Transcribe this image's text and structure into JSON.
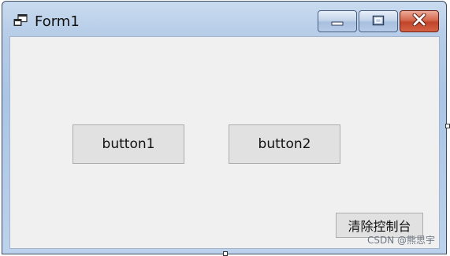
{
  "window": {
    "title": "Form1",
    "controls": {
      "minimize_icon": "minimize-icon",
      "maximize_icon": "maximize-icon",
      "close_icon": "close-icon"
    }
  },
  "form": {
    "button1_label": "button1",
    "button2_label": "button2",
    "clear_console_label": "清除控制台"
  },
  "watermark": "CSDN @熊思宇",
  "colors": {
    "client_background": "#f0f0f0",
    "button_face": "#e1e1e1",
    "close_button": "#c0452a"
  }
}
